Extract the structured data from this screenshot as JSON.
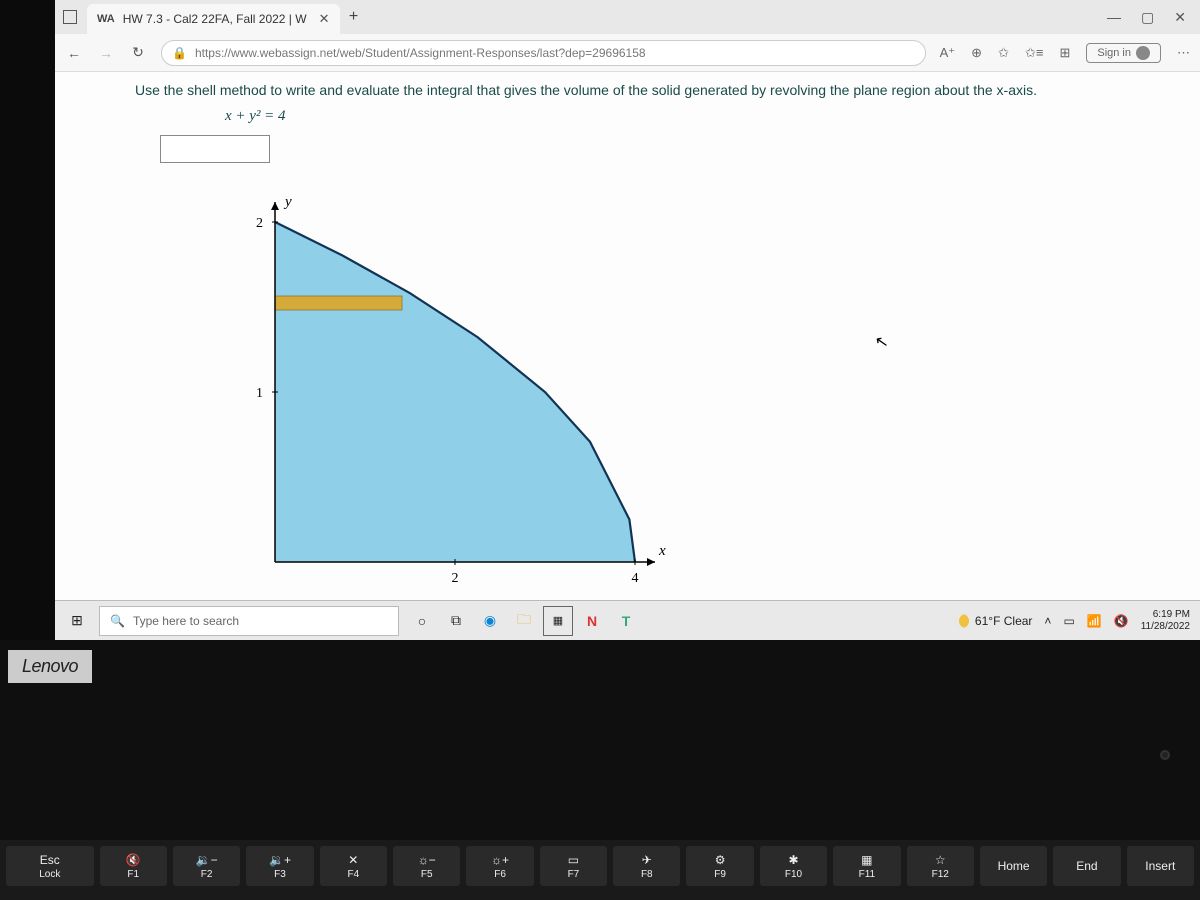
{
  "browser": {
    "tab_title": "HW 7.3 - Cal2 22FA, Fall 2022 | W",
    "favicon_text": "WA",
    "new_tab": "+",
    "win_min": "—",
    "win_max": "▢",
    "win_close": "✕",
    "nav_back": "←",
    "nav_fwd": "→",
    "nav_reload": "↻",
    "lock": "🔒",
    "url": "https://www.webassign.net/web/Student/Assignment-Responses/last?dep=29696158",
    "read_aloud": "A⁺",
    "zoom": "⊕",
    "fav": "✩",
    "collections": "⊞",
    "signin_label": "Sign in",
    "more": "⋯"
  },
  "page": {
    "instruction": "Use the shell method to write and evaluate the integral that gives the volume of the solid generated by revolving the plane region about the x-axis.",
    "equation": "x + y² = 4"
  },
  "chart_data": {
    "type": "area",
    "title": "",
    "xlabel": "x",
    "ylabel": "y",
    "xlim": [
      0,
      4.2
    ],
    "ylim": [
      0,
      2.2
    ],
    "xticks": [
      2,
      4
    ],
    "yticks": [
      1,
      2
    ],
    "curve_equation": "x = 4 - y^2",
    "curve_points_xy": [
      [
        0,
        2
      ],
      [
        0.75,
        1.803
      ],
      [
        1.5,
        1.581
      ],
      [
        2.25,
        1.323
      ],
      [
        3,
        1
      ],
      [
        3.5,
        0.707
      ],
      [
        3.9375,
        0.25
      ],
      [
        4,
        0
      ]
    ],
    "region_description": "bounded by x=0, y=0, and x = 4 - y^2 (y from 0 to 2)",
    "shell_strip_y_range": [
      1.5,
      1.6
    ]
  },
  "taskbar": {
    "search_placeholder": "Type here to search",
    "weather": "61°F Clear",
    "time": "6:19 PM",
    "date": "11/28/2022"
  },
  "laptop": {
    "brand": "Lenovo",
    "side_keys": {
      "esc": "Esc",
      "lock": "Lock"
    },
    "fn_keys": [
      {
        "sym": "🔇",
        "label": "F1"
      },
      {
        "sym": "🔉−",
        "label": "F2"
      },
      {
        "sym": "🔉+",
        "label": "F3"
      },
      {
        "sym": "✕",
        "label": "F4"
      },
      {
        "sym": "☼−",
        "label": "F5"
      },
      {
        "sym": "☼+",
        "label": "F6"
      },
      {
        "sym": "▭",
        "label": "F7"
      },
      {
        "sym": "✈",
        "label": "F8"
      },
      {
        "sym": "⚙",
        "label": "F9"
      },
      {
        "sym": "✱",
        "label": "F10"
      },
      {
        "sym": "▦",
        "label": "F11"
      },
      {
        "sym": "☆",
        "label": "F12"
      }
    ],
    "right_keys": [
      "Home",
      "End",
      "Insert"
    ]
  }
}
